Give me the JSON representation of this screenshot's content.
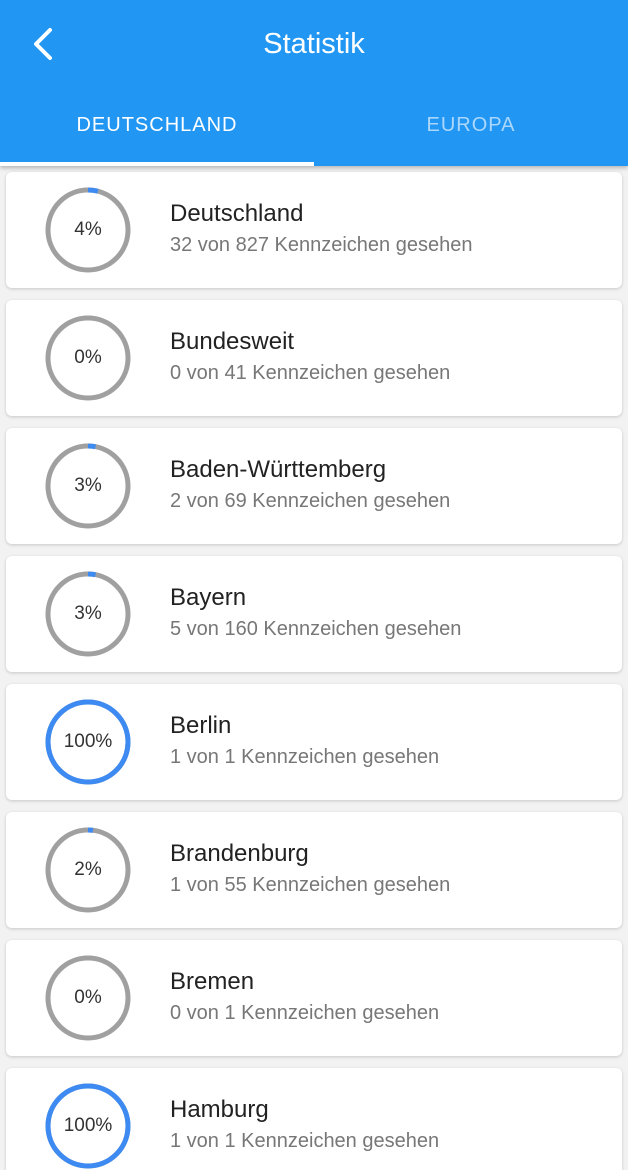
{
  "header": {
    "title": "Statistik",
    "back_icon": "chevron-left-icon"
  },
  "tabs": [
    {
      "label": "DEUTSCHLAND",
      "active": true
    },
    {
      "label": "EUROPA",
      "active": false
    }
  ],
  "colors": {
    "primary": "#2196f3",
    "progress": "#3d8bf2",
    "track": "#a0a0a0"
  },
  "regions": [
    {
      "name": "Deutschland",
      "subtitle": "32 von 827 Kennzeichen gesehen",
      "percent_label": "4%",
      "progress": 0.04
    },
    {
      "name": "Bundesweit",
      "subtitle": "0 von 41 Kennzeichen gesehen",
      "percent_label": "0%",
      "progress": 0.0
    },
    {
      "name": "Baden-Württemberg",
      "subtitle": "2 von 69 Kennzeichen gesehen",
      "percent_label": "3%",
      "progress": 0.03
    },
    {
      "name": "Bayern",
      "subtitle": "5 von 160 Kennzeichen gesehen",
      "percent_label": "3%",
      "progress": 0.03
    },
    {
      "name": "Berlin",
      "subtitle": "1 von 1 Kennzeichen gesehen",
      "percent_label": "100%",
      "progress": 1.0
    },
    {
      "name": "Brandenburg",
      "subtitle": "1 von 55 Kennzeichen gesehen",
      "percent_label": "2%",
      "progress": 0.02
    },
    {
      "name": "Bremen",
      "subtitle": "0 von 1 Kennzeichen gesehen",
      "percent_label": "0%",
      "progress": 0.0
    },
    {
      "name": "Hamburg",
      "subtitle": "1 von 1 Kennzeichen gesehen",
      "percent_label": "100%",
      "progress": 1.0
    }
  ]
}
